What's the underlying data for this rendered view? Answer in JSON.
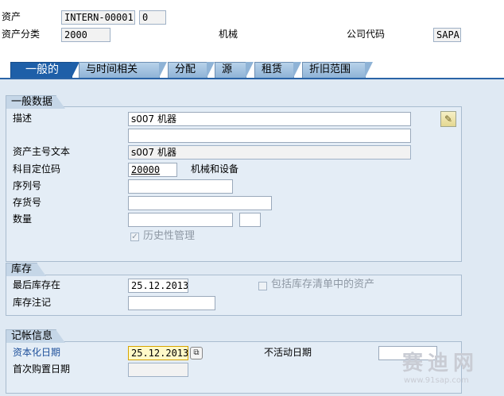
{
  "header": {
    "asset_label": "资产",
    "asset_number": "INTERN-00001",
    "sub_number": "0",
    "asset_class_label": "资产分类",
    "asset_class": "2000",
    "asset_class_text": "机械",
    "company_code_label": "公司代码",
    "company_code": "SAPA"
  },
  "tabs": [
    {
      "label": "一般的",
      "active": true
    },
    {
      "label": "与时间相关",
      "active": false
    },
    {
      "label": "分配",
      "active": false
    },
    {
      "label": "源",
      "active": false
    },
    {
      "label": "租赁",
      "active": false
    },
    {
      "label": "折旧范围",
      "active": false
    }
  ],
  "general_data": {
    "title": "一般数据",
    "description_label": "描述",
    "description_1": "s007 机器",
    "description_2": "",
    "main_text_label": "资产主号文本",
    "main_text": "s007 机器",
    "account_det_label": "科目定位码",
    "account_det": "20000",
    "account_det_text": "机械和设备",
    "serial_label": "序列号",
    "serial": "",
    "inventory_label": "存货号",
    "inventory": "",
    "quantity_label": "数量",
    "quantity": "",
    "unit": "",
    "history_label": "历史性管理",
    "history_checked": true
  },
  "inventory": {
    "title": "库存",
    "last_inventory_label": "最后库存在",
    "last_inventory": "25.12.2013",
    "include_label": "包括库存清单中的资产",
    "include_checked": false,
    "note_label": "库存注记",
    "note": ""
  },
  "posting": {
    "title": "记帐信息",
    "cap_date_label": "资本化日期",
    "cap_date": "25.12.2013",
    "deact_label": "不活动日期",
    "deact_date": "",
    "first_acq_label": "首次购置日期",
    "first_acq": ""
  },
  "watermark": {
    "text": "赛迪网",
    "url": "www.91sap.com"
  },
  "colors": {
    "active_tab": "#1e5fa8",
    "panel": "#dfe9f3",
    "link": "#1d4f9a"
  }
}
